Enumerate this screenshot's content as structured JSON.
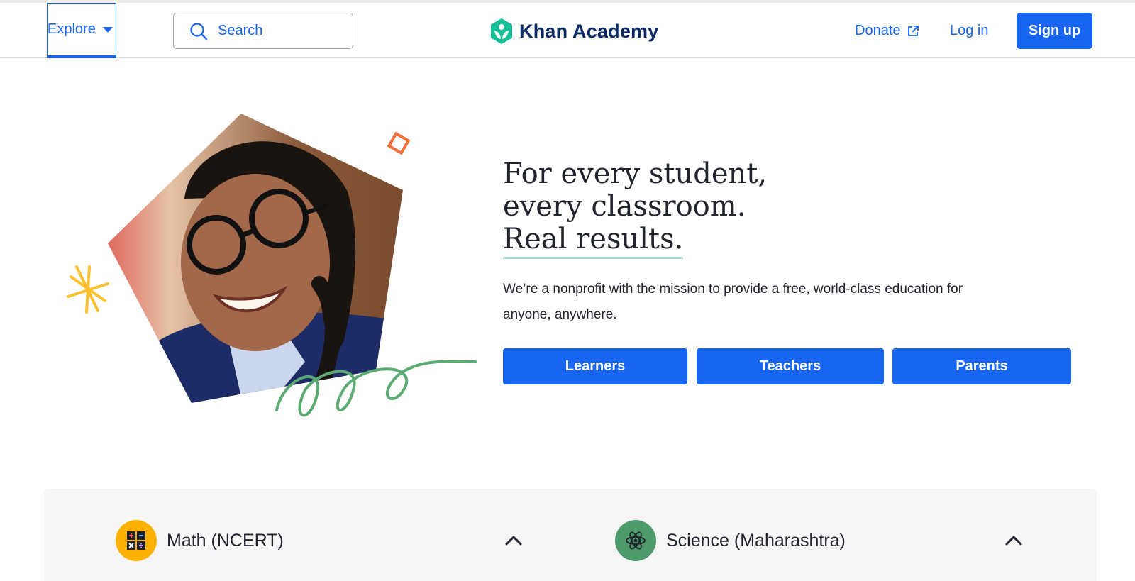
{
  "header": {
    "explore_label": "Explore",
    "search_placeholder": "Search",
    "logo_text": "Khan Academy",
    "donate_label": "Donate",
    "login_label": "Log in",
    "signup_label": "Sign up"
  },
  "hero": {
    "headline_lines": [
      "For every student,",
      "every classroom.",
      "Real results."
    ],
    "mission": "We’re a nonprofit with the mission to provide a free, world-class education for anyone, anywhere.",
    "buttons": [
      "Learners",
      "Teachers",
      "Parents"
    ]
  },
  "subjects": [
    {
      "name": "Math (NCERT)",
      "icon": "calculator-icon",
      "color": "#ffb100"
    },
    {
      "name": "Science (Maharashtra)",
      "icon": "atom-icon",
      "color": "#4d9a6a"
    }
  ],
  "colors": {
    "accent": "#1865f2",
    "logo_green": "#14bf96",
    "logo_navy": "#0a2a66",
    "headline_underline": "#a8ded1",
    "deco_orange": "#f56f39",
    "deco_yellow": "#ffc02e",
    "deco_green": "#5aaa71"
  }
}
